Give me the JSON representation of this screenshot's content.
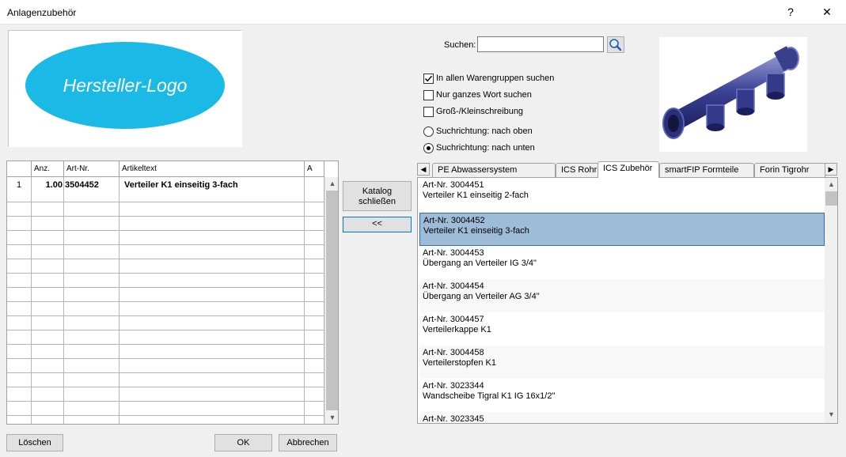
{
  "window": {
    "title": "Anlagenzubehör",
    "help_label": "?",
    "close_label": "✕"
  },
  "logo": {
    "text": "Hersteller-Logo"
  },
  "grid": {
    "columns": [
      {
        "label": ""
      },
      {
        "label": "Anz."
      },
      {
        "label": "Art-Nr."
      },
      {
        "label": "Artikeltext"
      },
      {
        "label": "A"
      }
    ],
    "rows": [
      {
        "index": "1",
        "qty": "1.00",
        "artnr": "3504452",
        "text": "Verteiler K1 einseitig 3-fach"
      }
    ]
  },
  "middle": {
    "close_catalog_label": "Katalog\nschließen",
    "transfer_label": "<<"
  },
  "search": {
    "label": "Suchen:",
    "value": "",
    "options": [
      {
        "label": "In allen Warengruppen suchen",
        "checked": true
      },
      {
        "label": "Nur ganzes Wort suchen",
        "checked": false
      },
      {
        "label": "Groß-/Kleinschreibung",
        "checked": false
      }
    ],
    "direction": [
      {
        "label": "Suchrichtung: nach oben",
        "selected": false
      },
      {
        "label": "Suchrichtung: nach unten",
        "selected": true
      }
    ]
  },
  "tabs": [
    {
      "label": "PE Abwassersystem"
    },
    {
      "label": "ICS Rohr"
    },
    {
      "label": "ICS Zubehör"
    },
    {
      "label": "smartFIP Formteile"
    },
    {
      "label": "Forin Tigrohr"
    }
  ],
  "active_tab": "ICS Zubehör",
  "catalog": [
    {
      "artnr": "Art-Nr. 3004451",
      "text": "Verteiler K1 einseitig 2-fach"
    },
    {
      "artnr": "Art-Nr. 3004452",
      "text": "Verteiler K1 einseitig 3-fach"
    },
    {
      "artnr": "Art-Nr. 3004453",
      "text": "Übergang an Verteiler IG 3/4\""
    },
    {
      "artnr": "Art-Nr. 3004454",
      "text": "Übergang an Verteiler AG 3/4\""
    },
    {
      "artnr": "Art-Nr. 3004457",
      "text": "Verteilerkappe K1"
    },
    {
      "artnr": "Art-Nr. 3004458",
      "text": "Verteilerstopfen K1"
    },
    {
      "artnr": "Art-Nr. 3023344",
      "text": "Wandscheibe Tigral K1 IG 16x1/2\""
    },
    {
      "artnr": "Art-Nr. 3023345",
      "text": ""
    }
  ],
  "catalog_selected": "Art-Nr. 3004452",
  "footer": {
    "delete_label": "Löschen",
    "ok_label": "OK",
    "cancel_label": "Abbrechen"
  },
  "colors": {
    "logo_fill": "#1ab9e6",
    "selection": "#9ebcd7",
    "selection_border": "#2f6cb8",
    "focus_border": "#0078d7"
  }
}
